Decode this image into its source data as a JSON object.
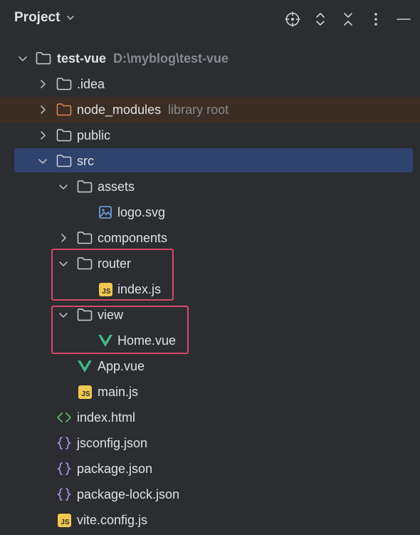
{
  "header": {
    "title": "Project",
    "icons": [
      "target-icon",
      "expand-icon",
      "collapse-icon",
      "more-icon",
      "minimize-icon"
    ]
  },
  "colors": {
    "background": "#2b2d30",
    "selection": "#2e436e",
    "excluded_row": "#3b2e24",
    "highlight_box": "#d4496a",
    "vue_green": "#41b883",
    "js_yellow": "#f0c850",
    "json_purple": "#b894ff"
  },
  "tree": [
    {
      "name": "test-vue",
      "hint": "D:\\myblog\\test-vue",
      "icon": "folder-icon",
      "expanded": true
    },
    {
      "name": ".idea",
      "icon": "folder-icon",
      "expanded": false
    },
    {
      "name": "node_modules",
      "hint": "library root",
      "icon": "folder-icon-excluded",
      "expanded": false
    },
    {
      "name": "public",
      "icon": "folder-icon",
      "expanded": false
    },
    {
      "name": "src",
      "icon": "folder-icon",
      "expanded": true,
      "selected": true
    },
    {
      "name": "assets",
      "icon": "folder-icon",
      "expanded": true
    },
    {
      "name": "logo.svg",
      "icon": "image-file-icon"
    },
    {
      "name": "components",
      "icon": "folder-icon",
      "expanded": false
    },
    {
      "name": "router",
      "icon": "folder-icon",
      "expanded": true
    },
    {
      "name": "index.js",
      "icon": "js-file-icon",
      "badge": "JS"
    },
    {
      "name": "view",
      "icon": "folder-icon",
      "expanded": true
    },
    {
      "name": "Home.vue",
      "icon": "vue-file-icon"
    },
    {
      "name": "App.vue",
      "icon": "vue-file-icon"
    },
    {
      "name": "main.js",
      "icon": "js-file-icon",
      "badge": "JS"
    },
    {
      "name": "index.html",
      "icon": "html-file-icon"
    },
    {
      "name": "jsconfig.json",
      "icon": "json-file-icon"
    },
    {
      "name": "package.json",
      "icon": "json-file-icon"
    },
    {
      "name": "package-lock.json",
      "icon": "json-file-icon"
    },
    {
      "name": "vite.config.js",
      "icon": "js-file-icon",
      "badge": "JS"
    }
  ]
}
